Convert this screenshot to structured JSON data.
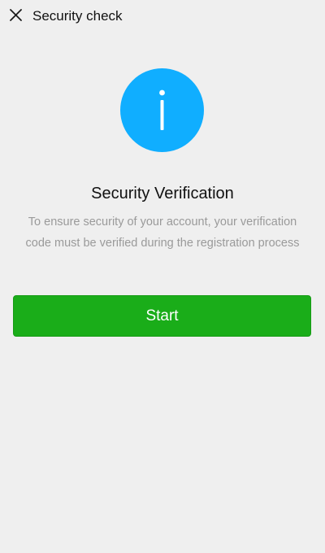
{
  "header": {
    "title": "Security check",
    "close_icon": "close-icon"
  },
  "main": {
    "icon": "info-icon",
    "icon_color": "#10aeff",
    "title": "Security Verification",
    "description": "To ensure security of your account, your verification code must be verified during the registration process",
    "start_label": "Start",
    "start_color": "#1aad19"
  }
}
